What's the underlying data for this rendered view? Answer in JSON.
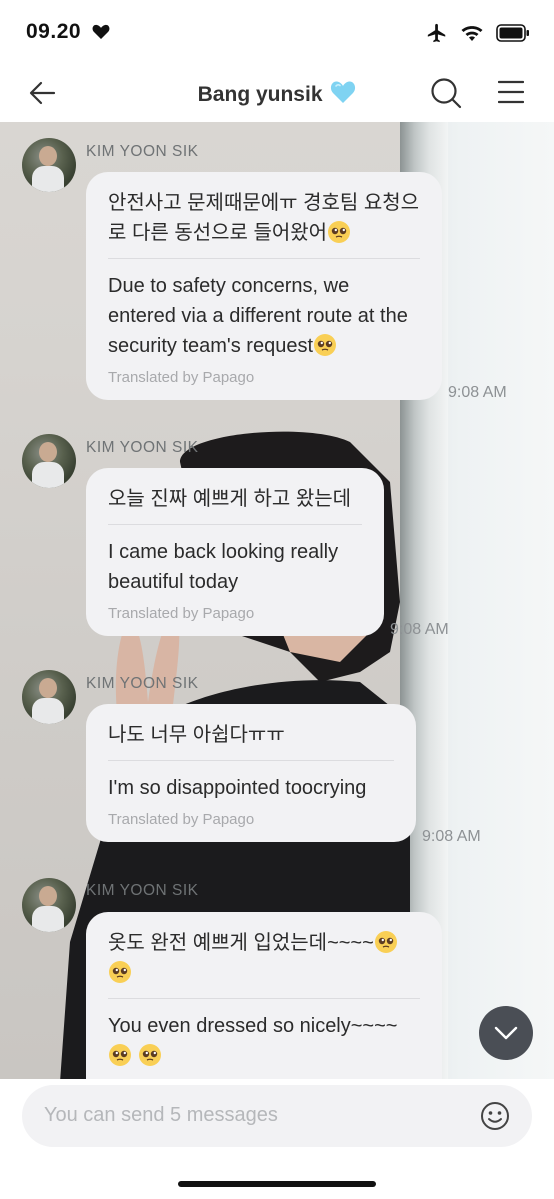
{
  "status": {
    "time": "09.20"
  },
  "header": {
    "title": "Bang yunsik",
    "title_emoji": "blue-heart"
  },
  "colors": {
    "bubble": "#f2f2f4",
    "header_text": "#333333",
    "scroll_button": "#4a4e55",
    "timestamp": "#8d9194"
  },
  "messages": [
    {
      "sender": "KIM YOON SIK",
      "original": "안전사고 문제때문에ㅠ 경호팀 요청으로 다른 동선으로 들어왔어",
      "translation": "Due to safety concerns, we entered via a different route at the security team's request",
      "translated_by": "Translated by Papago",
      "time": "9:08 AM"
    },
    {
      "sender": "KIM YOON SIK",
      "original": "오늘 진짜 예쁘게 하고 왔는데",
      "translation": "I came back looking really beautiful today",
      "translated_by": "Translated by Papago",
      "time": "9:08 AM"
    },
    {
      "sender": "KIM YOON SIK",
      "original": "나도 너무 아쉽다ㅠㅠ",
      "translation": "I'm so disappointed toocrying",
      "translated_by": "Translated by Papago",
      "time": "9:08 AM"
    },
    {
      "sender": "KIM YOON SIK",
      "original": "옷도 완전 예쁘게 입었는데~~~~",
      "translation": "You even dressed so nicely~~~~",
      "translated_by": "",
      "time": ""
    }
  ],
  "composer": {
    "placeholder": "You can send 5 messages"
  },
  "icons": {
    "back": "arrow-left-icon",
    "search": "search-icon",
    "menu": "hamburger-menu-icon",
    "airplane": "airplane-icon",
    "wifi": "wifi-icon",
    "battery": "battery-icon",
    "scroll_down": "chevron-down-icon",
    "emoji": "smiley-icon"
  }
}
